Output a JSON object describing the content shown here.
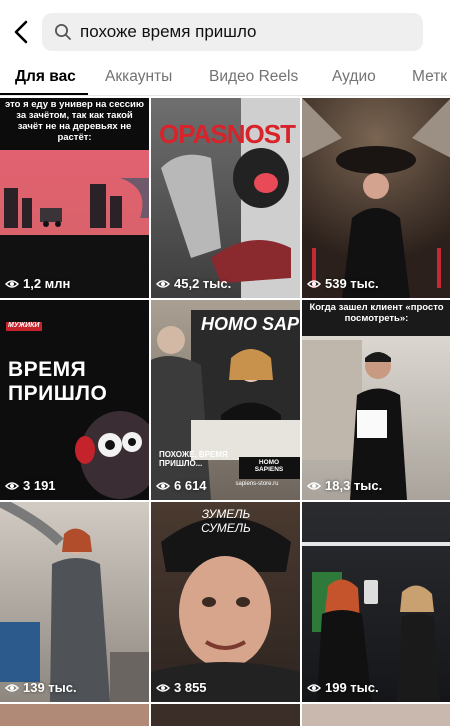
{
  "search": {
    "query": "похоже время пришло"
  },
  "tabs": [
    "Для вас",
    "Аккаунты",
    "Видео Reels",
    "Аудио",
    "Метк"
  ],
  "tiles": [
    {
      "views": "1,2 млн",
      "caption": "это я еду в универ на сессию за зачётом, так как такой зачёт не на деревьях не растёт:"
    },
    {
      "views": "45,2 тыс.",
      "caption": "OPASNOST"
    },
    {
      "views": "539 тыс."
    },
    {
      "views": "3 191",
      "caption": "ВРЕМЯ ПРИШЛО",
      "badge": "МУЖИКИ"
    },
    {
      "views": "6 614",
      "caption": "HOMO SAP",
      "subcaption": "ПОХОЖЕ, ВРЕМЯ ПРИШЛО...",
      "logo": "HOMO SAPIENS",
      "site": "sapiens-store.ru"
    },
    {
      "views": "18,3 тыс.",
      "caption": "Когда зашел клиент «просто посмотреть»:"
    },
    {
      "views": "139 тыс."
    },
    {
      "views": "3 855",
      "caption": "ЗУМЕЛЬ СУМЕЛЬ"
    },
    {
      "views": "199 тыс."
    }
  ],
  "colors": {
    "accent": "#000000",
    "inactive_tab": "#737373",
    "search_bg": "#efefef"
  }
}
